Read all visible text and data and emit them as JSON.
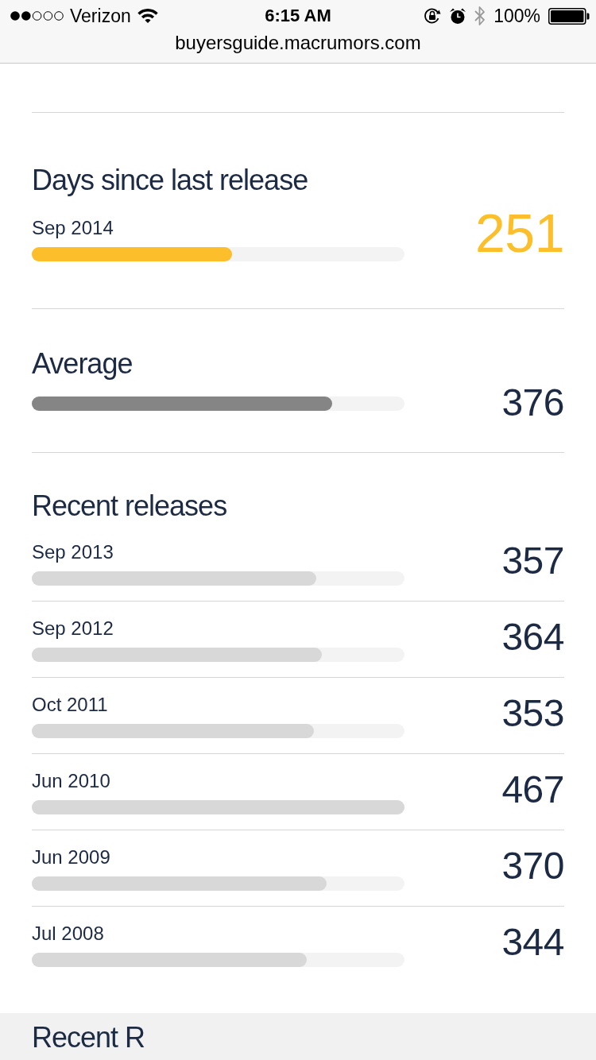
{
  "status_bar": {
    "carrier": "Verizon",
    "time": "6:15 AM",
    "battery": "100%"
  },
  "address_bar": {
    "url": "buyersguide.macrumors.com"
  },
  "sections": [
    {
      "kind": "current",
      "title": "Days since last release",
      "rows": [
        {
          "label": "Sep 2014",
          "value": "251",
          "level": 0.537
        }
      ]
    },
    {
      "kind": "average",
      "title": "Average",
      "rows": [
        {
          "value": "376",
          "level": 0.805
        }
      ]
    },
    {
      "kind": "history",
      "title": "Recent releases",
      "rows": [
        {
          "label": "Sep 2013",
          "value": "357",
          "level": 0.764
        },
        {
          "label": "Sep 2012",
          "value": "364",
          "level": 0.779
        },
        {
          "label": "Oct 2011",
          "value": "353",
          "level": 0.756
        },
        {
          "label": "Jun 2010",
          "value": "467",
          "level": 1
        },
        {
          "label": "Jun 2009",
          "value": "370",
          "level": 0.792
        },
        {
          "label": "Jul 2008",
          "value": "344",
          "level": 0.737
        }
      ]
    }
  ],
  "next_section": {
    "title": "Recent R"
  }
}
